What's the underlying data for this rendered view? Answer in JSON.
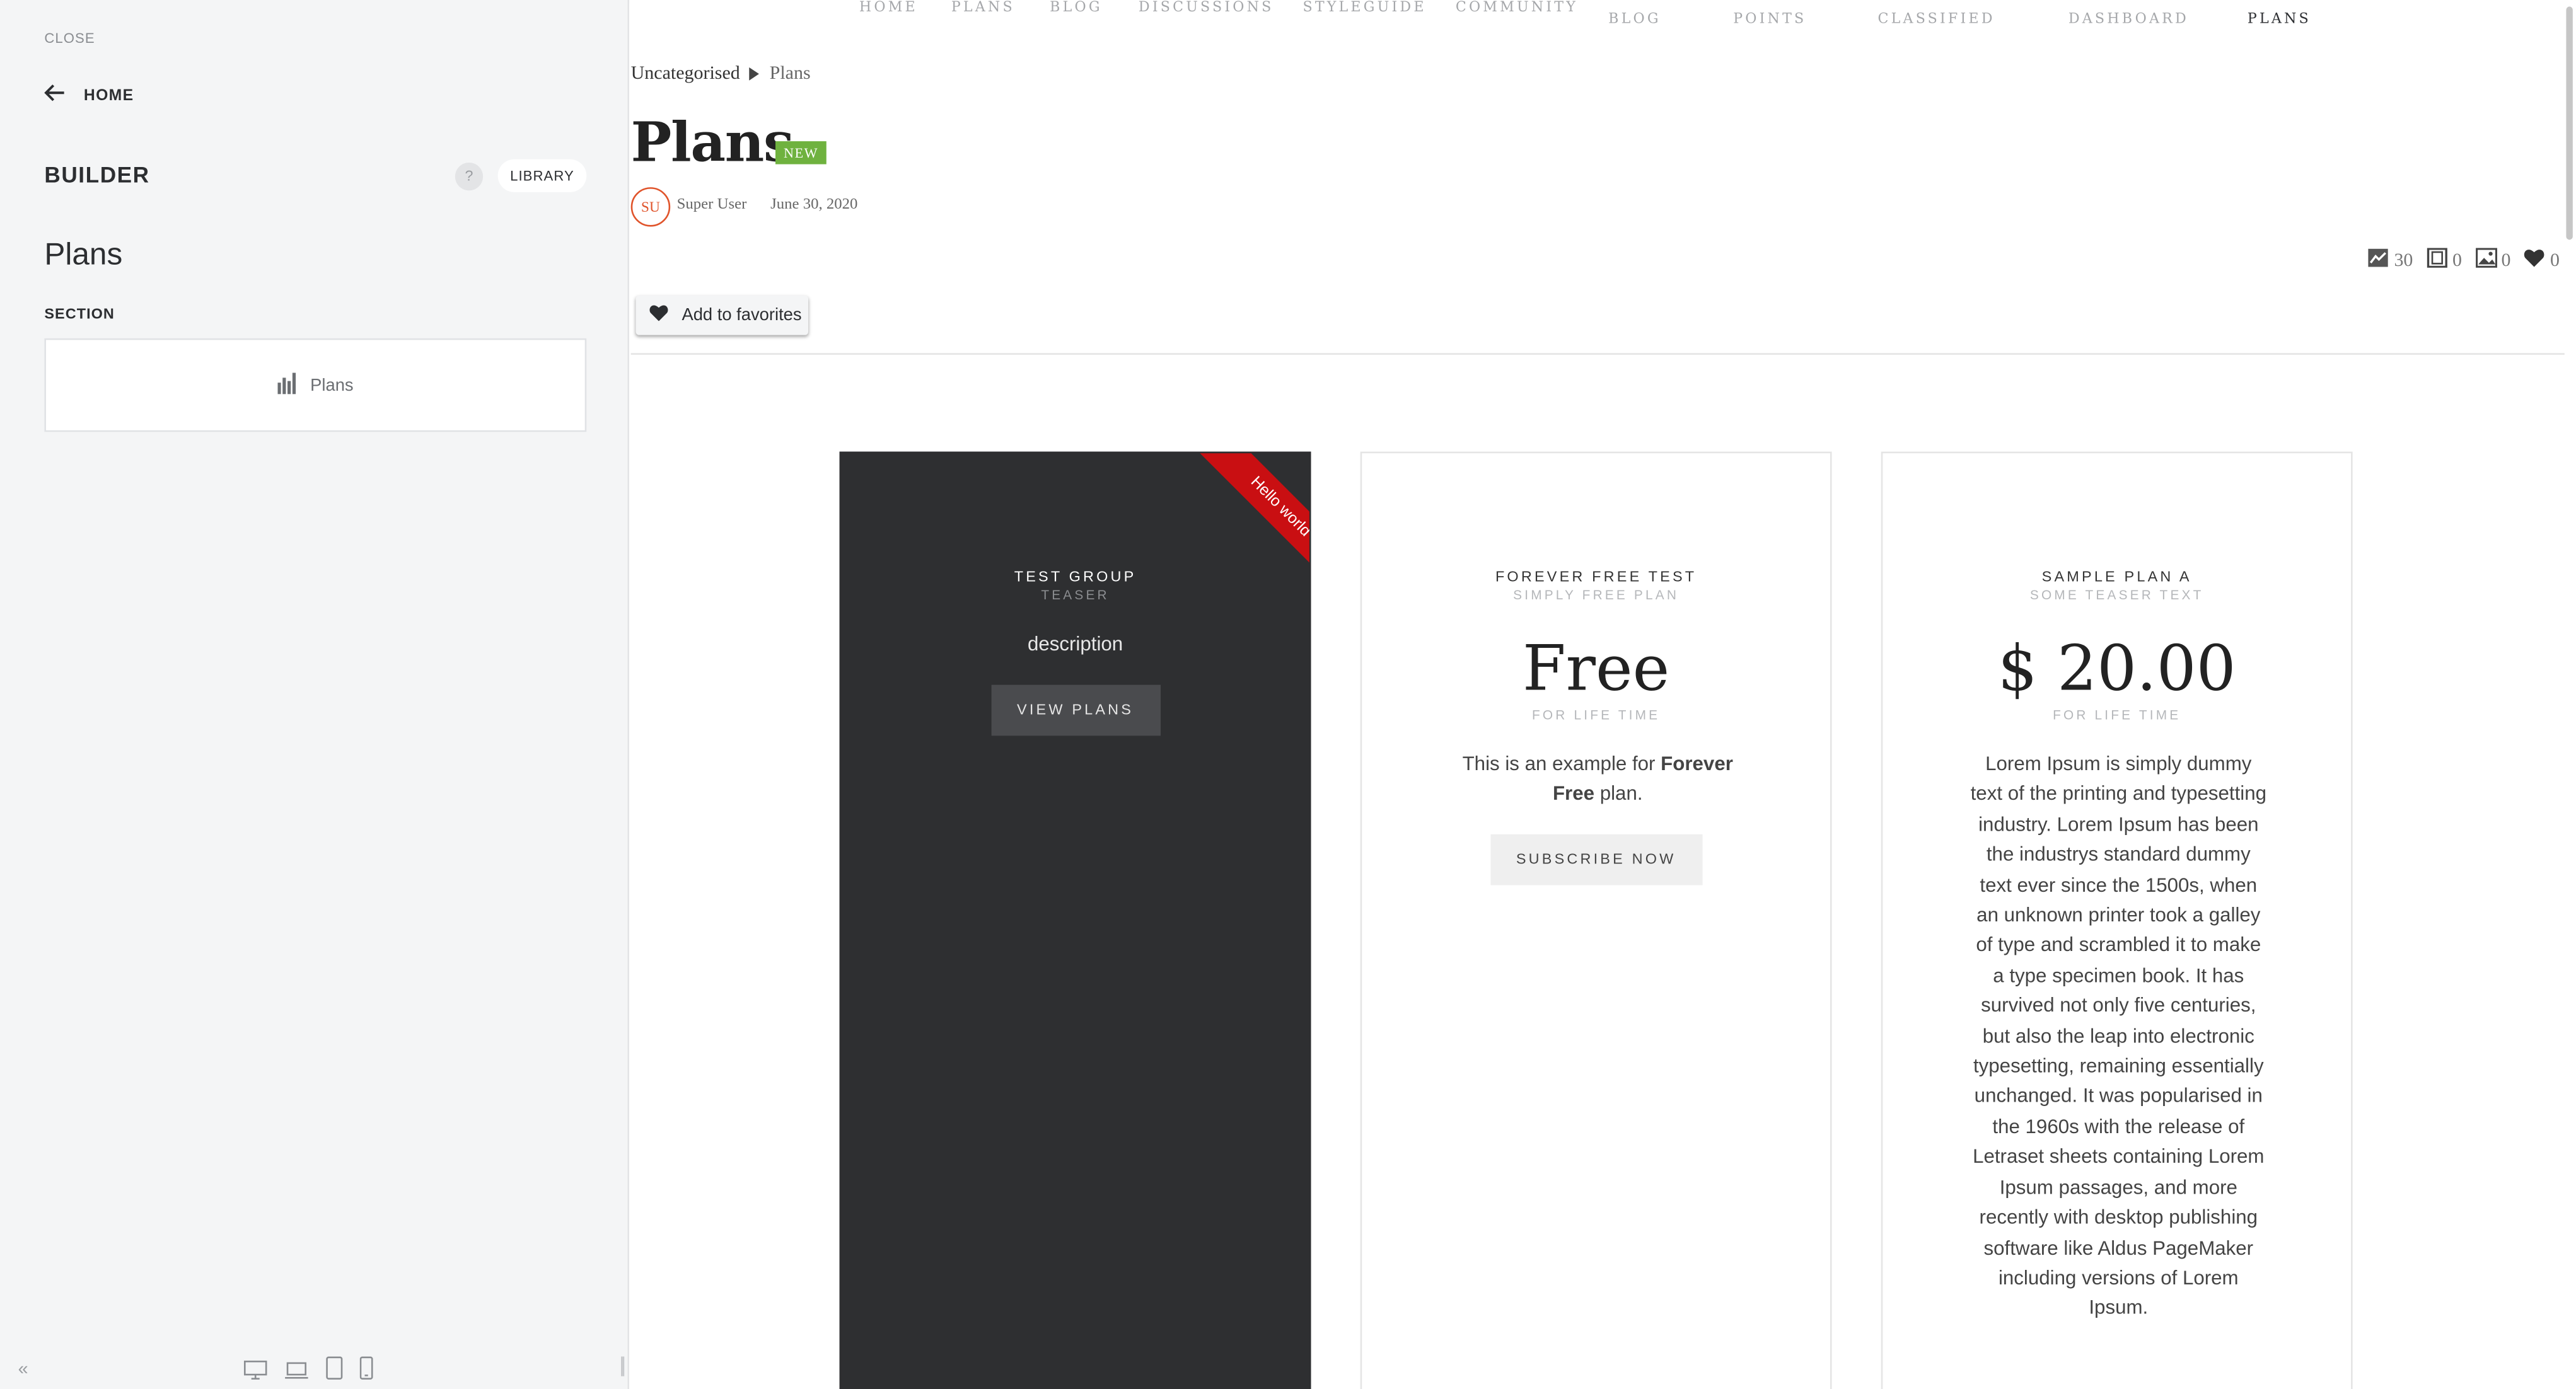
{
  "sidebar": {
    "close_label": "CLOSE",
    "home_label": "HOME",
    "builder_title": "BUILDER",
    "help_label": "?",
    "library_label": "LIBRARY",
    "plans_heading": "Plans",
    "section_label": "SECTION",
    "section_item_label": "Plans",
    "collapse_label": "«",
    "icons": [
      "arrow-left-icon",
      "bar-chart-icon",
      "desktop-icon",
      "laptop-icon",
      "tablet-icon",
      "phone-icon"
    ]
  },
  "nav": {
    "top_row": [
      "HOME",
      "PLANS",
      "BLOG",
      "DISCUSSIONS",
      "STYLEGUIDE",
      "COMMUNITY"
    ],
    "sub_row": [
      "BLOG",
      "POINTS",
      "CLASSIFIED",
      "DASHBOARD",
      "PLANS"
    ],
    "active": "PLANS"
  },
  "breadcrumb": {
    "parent": "Uncategorised",
    "current": "Plans"
  },
  "page": {
    "title": "Plans",
    "badge": "NEW",
    "avatar_initials": "SU",
    "author": "Super User",
    "date": "June 30, 2020",
    "stats": [
      {
        "icon": "hits-icon",
        "value": "30"
      },
      {
        "icon": "film-icon",
        "value": "0"
      },
      {
        "icon": "image-icon",
        "value": "0"
      },
      {
        "icon": "heart-icon",
        "value": "0"
      }
    ],
    "favorites_label": "Add to favorites"
  },
  "plans": [
    {
      "name": "TEST GROUP",
      "teaser": "TEASER",
      "description": "description",
      "button": "VIEW PLANS",
      "ribbon": "Hello world"
    },
    {
      "name": "FOREVER FREE TEST",
      "teaser": "SIMPLY FREE PLAN",
      "price": "Free",
      "price_sub": "FOR LIFE TIME",
      "text_before": "This is an example for ",
      "text_bold": "Forever Free",
      "text_after": " plan.",
      "button": "SUBSCRIBE NOW"
    },
    {
      "name": "SAMPLE PLAN A",
      "teaser": "SOME TEASER TEXT",
      "price": "$ 20.00",
      "price_sub": "FOR LIFE TIME",
      "text": "Lorem Ipsum is simply dummy text of the printing and typesetting industry. Lorem Ipsum has been the industrys standard dummy text ever since the 1500s, when an unknown printer took a galley of type and scrambled it to make a type specimen book. It has survived not only five centuries, but also the leap into electronic typesetting, remaining essentially unchanged. It was popularised in the 1960s with the release of Letraset sheets containing Lorem Ipsum passages, and more recently with desktop publishing software like Aldus PageMaker including versions of Lorem Ipsum."
    }
  ],
  "colors": {
    "sidebar_bg": "#f4f5f6",
    "badge_green": "#6fb23f",
    "ribbon_red": "#c90f12",
    "dark_card": "#2e2f31",
    "avatar_orange": "#e0542b"
  }
}
